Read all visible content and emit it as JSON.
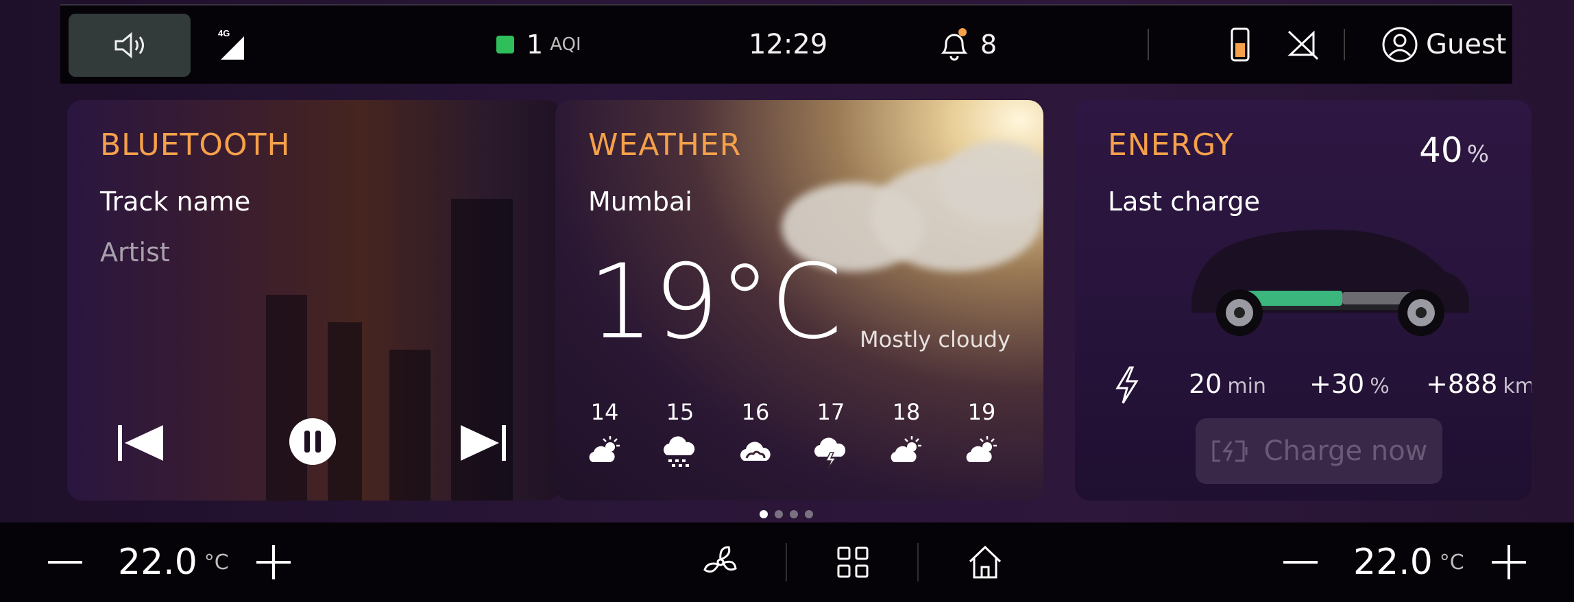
{
  "status_bar": {
    "network": "4G",
    "aqi_value": "1",
    "aqi_label": "AQI",
    "time": "12:29",
    "notifications_count": "8",
    "user": "Guest",
    "aqi_color": "#2fbf5a"
  },
  "bluetooth": {
    "title": "BLUETOOTH",
    "track": "Track name",
    "artist": "Artist"
  },
  "weather": {
    "title": "WEATHER",
    "city": "Mumbai",
    "temperature": "19°C",
    "condition": "Mostly cloudy",
    "forecast": [
      {
        "day": "14",
        "icon": "partly-sunny-icon"
      },
      {
        "day": "15",
        "icon": "snow-cloud-icon"
      },
      {
        "day": "16",
        "icon": "cloud-icon"
      },
      {
        "day": "17",
        "icon": "thunderstorm-icon"
      },
      {
        "day": "18",
        "icon": "partly-sunny-icon"
      },
      {
        "day": "19",
        "icon": "partly-sunny-icon"
      }
    ]
  },
  "energy": {
    "title": "ENERGY",
    "percent": "40",
    "percent_unit": "%",
    "subtitle": "Last charge",
    "duration": "20",
    "duration_unit": "min",
    "charge_gain": "+30",
    "charge_gain_unit": "%",
    "range_gain": "+888",
    "range_unit": "km",
    "charge_button": "Charge now"
  },
  "pager": {
    "total": 4,
    "active": 0
  },
  "climate": {
    "left_temp": "22.0",
    "right_temp": "22.0",
    "unit": "°C"
  },
  "colors": {
    "accent": "#f5a04a"
  }
}
